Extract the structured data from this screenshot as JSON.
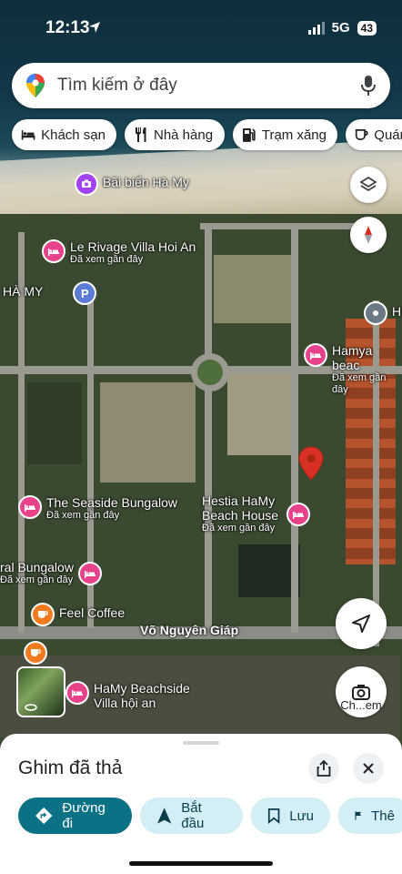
{
  "status_bar": {
    "time": "12:13",
    "network": "5G",
    "battery": "43"
  },
  "search": {
    "placeholder": "Tìm kiếm ở đây"
  },
  "chips": [
    {
      "label": "Khách sạn",
      "icon": "bed-icon"
    },
    {
      "label": "Nhà hàng",
      "icon": "fork-knife-icon"
    },
    {
      "label": "Trạm xăng",
      "icon": "gas-station-icon"
    },
    {
      "label": "Quán",
      "icon": "coffee-icon"
    }
  ],
  "map": {
    "pois": [
      {
        "name": "Bãi biển Hà My",
        "sub": "",
        "icon": "camera-icon",
        "color": "#a142f4"
      },
      {
        "name": "Le Rivage Villa Hoi An",
        "sub": "Đã xem gần đây",
        "icon": "bed-icon",
        "color": "#e8428a"
      },
      {
        "name": "HÀ MY",
        "sub": "",
        "icon": "parking-icon",
        "color": "#5b7bd5"
      },
      {
        "name": "Hamya beac",
        "sub": "Đã xem gần đây",
        "icon": "bed-icon",
        "color": "#e8428a"
      },
      {
        "name": "The Seaside Bungalow",
        "sub": "Đã xem gần đây",
        "icon": "bed-icon",
        "color": "#e8428a"
      },
      {
        "name": "Hestia HaMy Beach House",
        "sub": "Đã xem gần đây",
        "icon": "bed-icon",
        "color": "#e8428a"
      },
      {
        "name": "ral Bungalow",
        "sub": "Đã xem gần đây",
        "icon": "bed-icon",
        "color": "#e8428a"
      },
      {
        "name": "Feel Coffee",
        "sub": "",
        "icon": "coffee-icon",
        "color": "#f27b1f"
      },
      {
        "name": "HaMy Beachside Villa hội an",
        "sub": "",
        "icon": "bed-icon",
        "color": "#e8428a"
      },
      {
        "name": "H",
        "sub": "",
        "icon": "pin-icon",
        "color": "#6b7a86"
      }
    ],
    "street": "Võ Nguyên Giáp",
    "lens_label": "Ch...em"
  },
  "sheet": {
    "title": "Ghim đã thả",
    "actions": [
      {
        "label": "Đường đi",
        "icon": "directions-icon"
      },
      {
        "label": "Bắt đầu",
        "icon": "navigation-arrow-icon"
      },
      {
        "label": "Lưu",
        "icon": "bookmark-icon"
      },
      {
        "label": "Thê",
        "icon": "flag-icon"
      }
    ]
  },
  "colors": {
    "primary": "#0b57d0",
    "accent_teal": "#0b7285",
    "pin_red": "#d93025",
    "hotel_pink": "#e8428a"
  }
}
